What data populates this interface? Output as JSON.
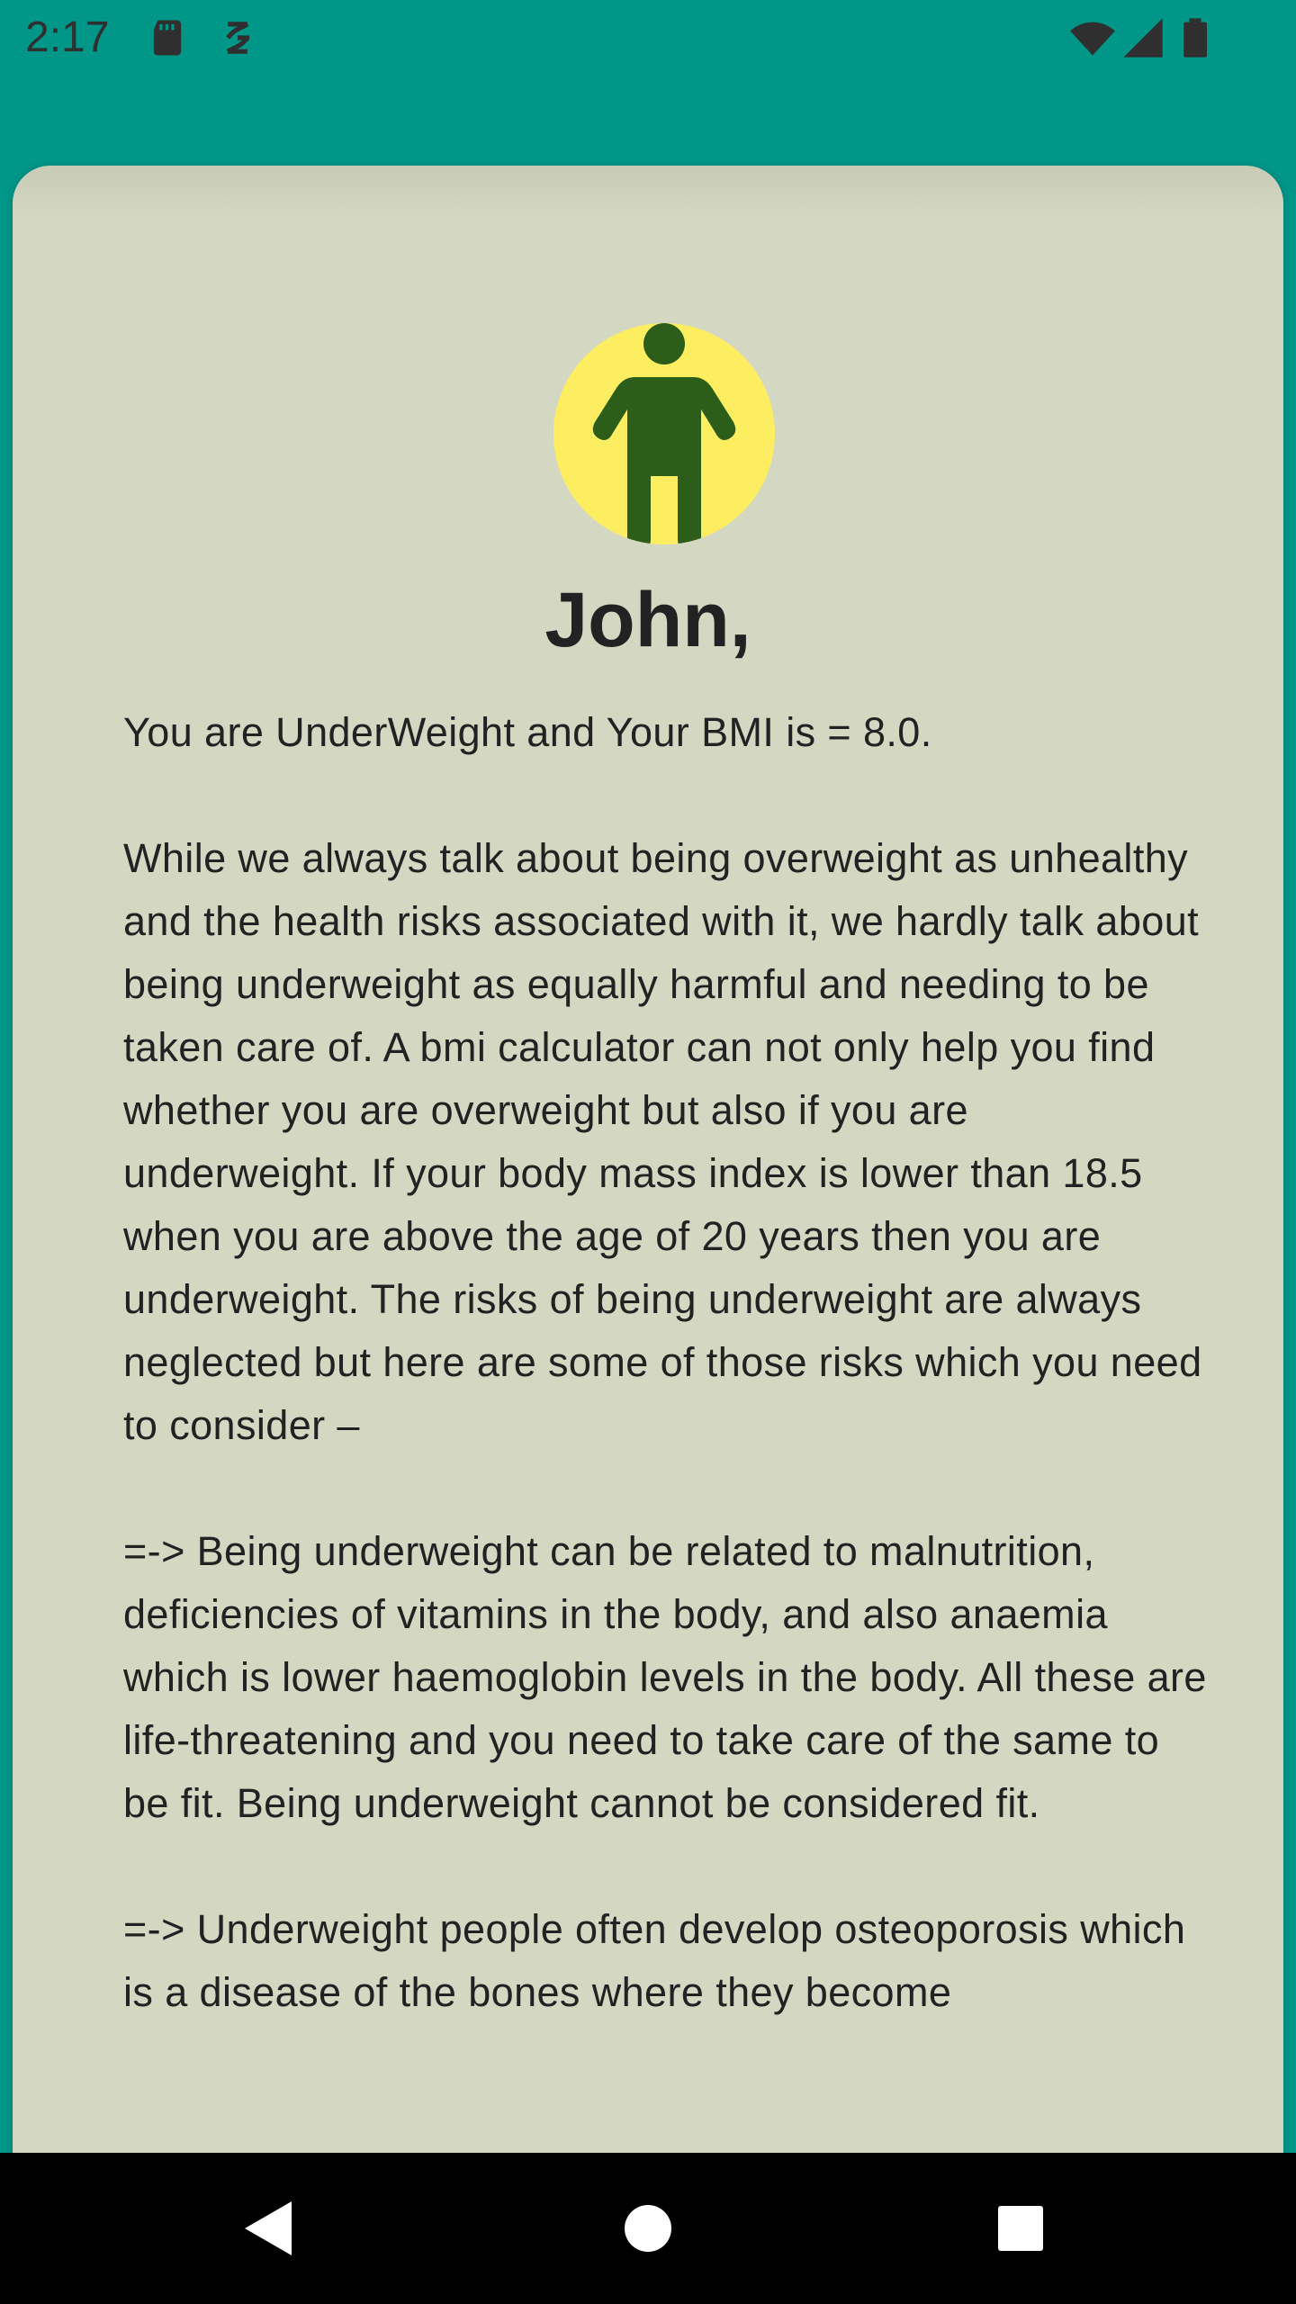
{
  "status_bar": {
    "time": "2:17",
    "icons": [
      "sd-card-icon",
      "sync-icon",
      "wifi-icon",
      "signal-icon",
      "battery-icon"
    ]
  },
  "colors": {
    "app_background": "#009688",
    "card_background": "#d4d8c2",
    "avatar_background": "#fdee61",
    "avatar_figure": "#2c5e1a",
    "text": "#222222"
  },
  "result": {
    "avatar_icon": "person-icon",
    "name": "John,",
    "paragraphs": [
      "You are UnderWeight and Your BMI is = 8.0.",
      "While we always talk about being overweight as unhealthy and the health risks associated with it, we hardly talk about being underweight as equally harmful and needing to be taken care of. A bmi calculator can not only help you find whether you are overweight but also if you are underweight. If your body mass index is lower than 18.5 when you are above the age of 20 years then you are underweight. The risks of being underweight are always neglected but here are some of those risks which you need to consider –",
      "=-> Being underweight can be related to malnutrition, deficiencies of vitamins in the body, and also anaemia which is lower haemoglobin levels in the body. All these are life-threatening and you need to take care of the same to be fit. Being underweight cannot be considered fit.",
      "=-> Underweight people often develop osteoporosis which is a disease of the bones where they become"
    ]
  },
  "nav_bar": {
    "back_icon": "back-triangle-icon",
    "home_icon": "home-circle-icon",
    "recents_icon": "recents-square-icon"
  }
}
